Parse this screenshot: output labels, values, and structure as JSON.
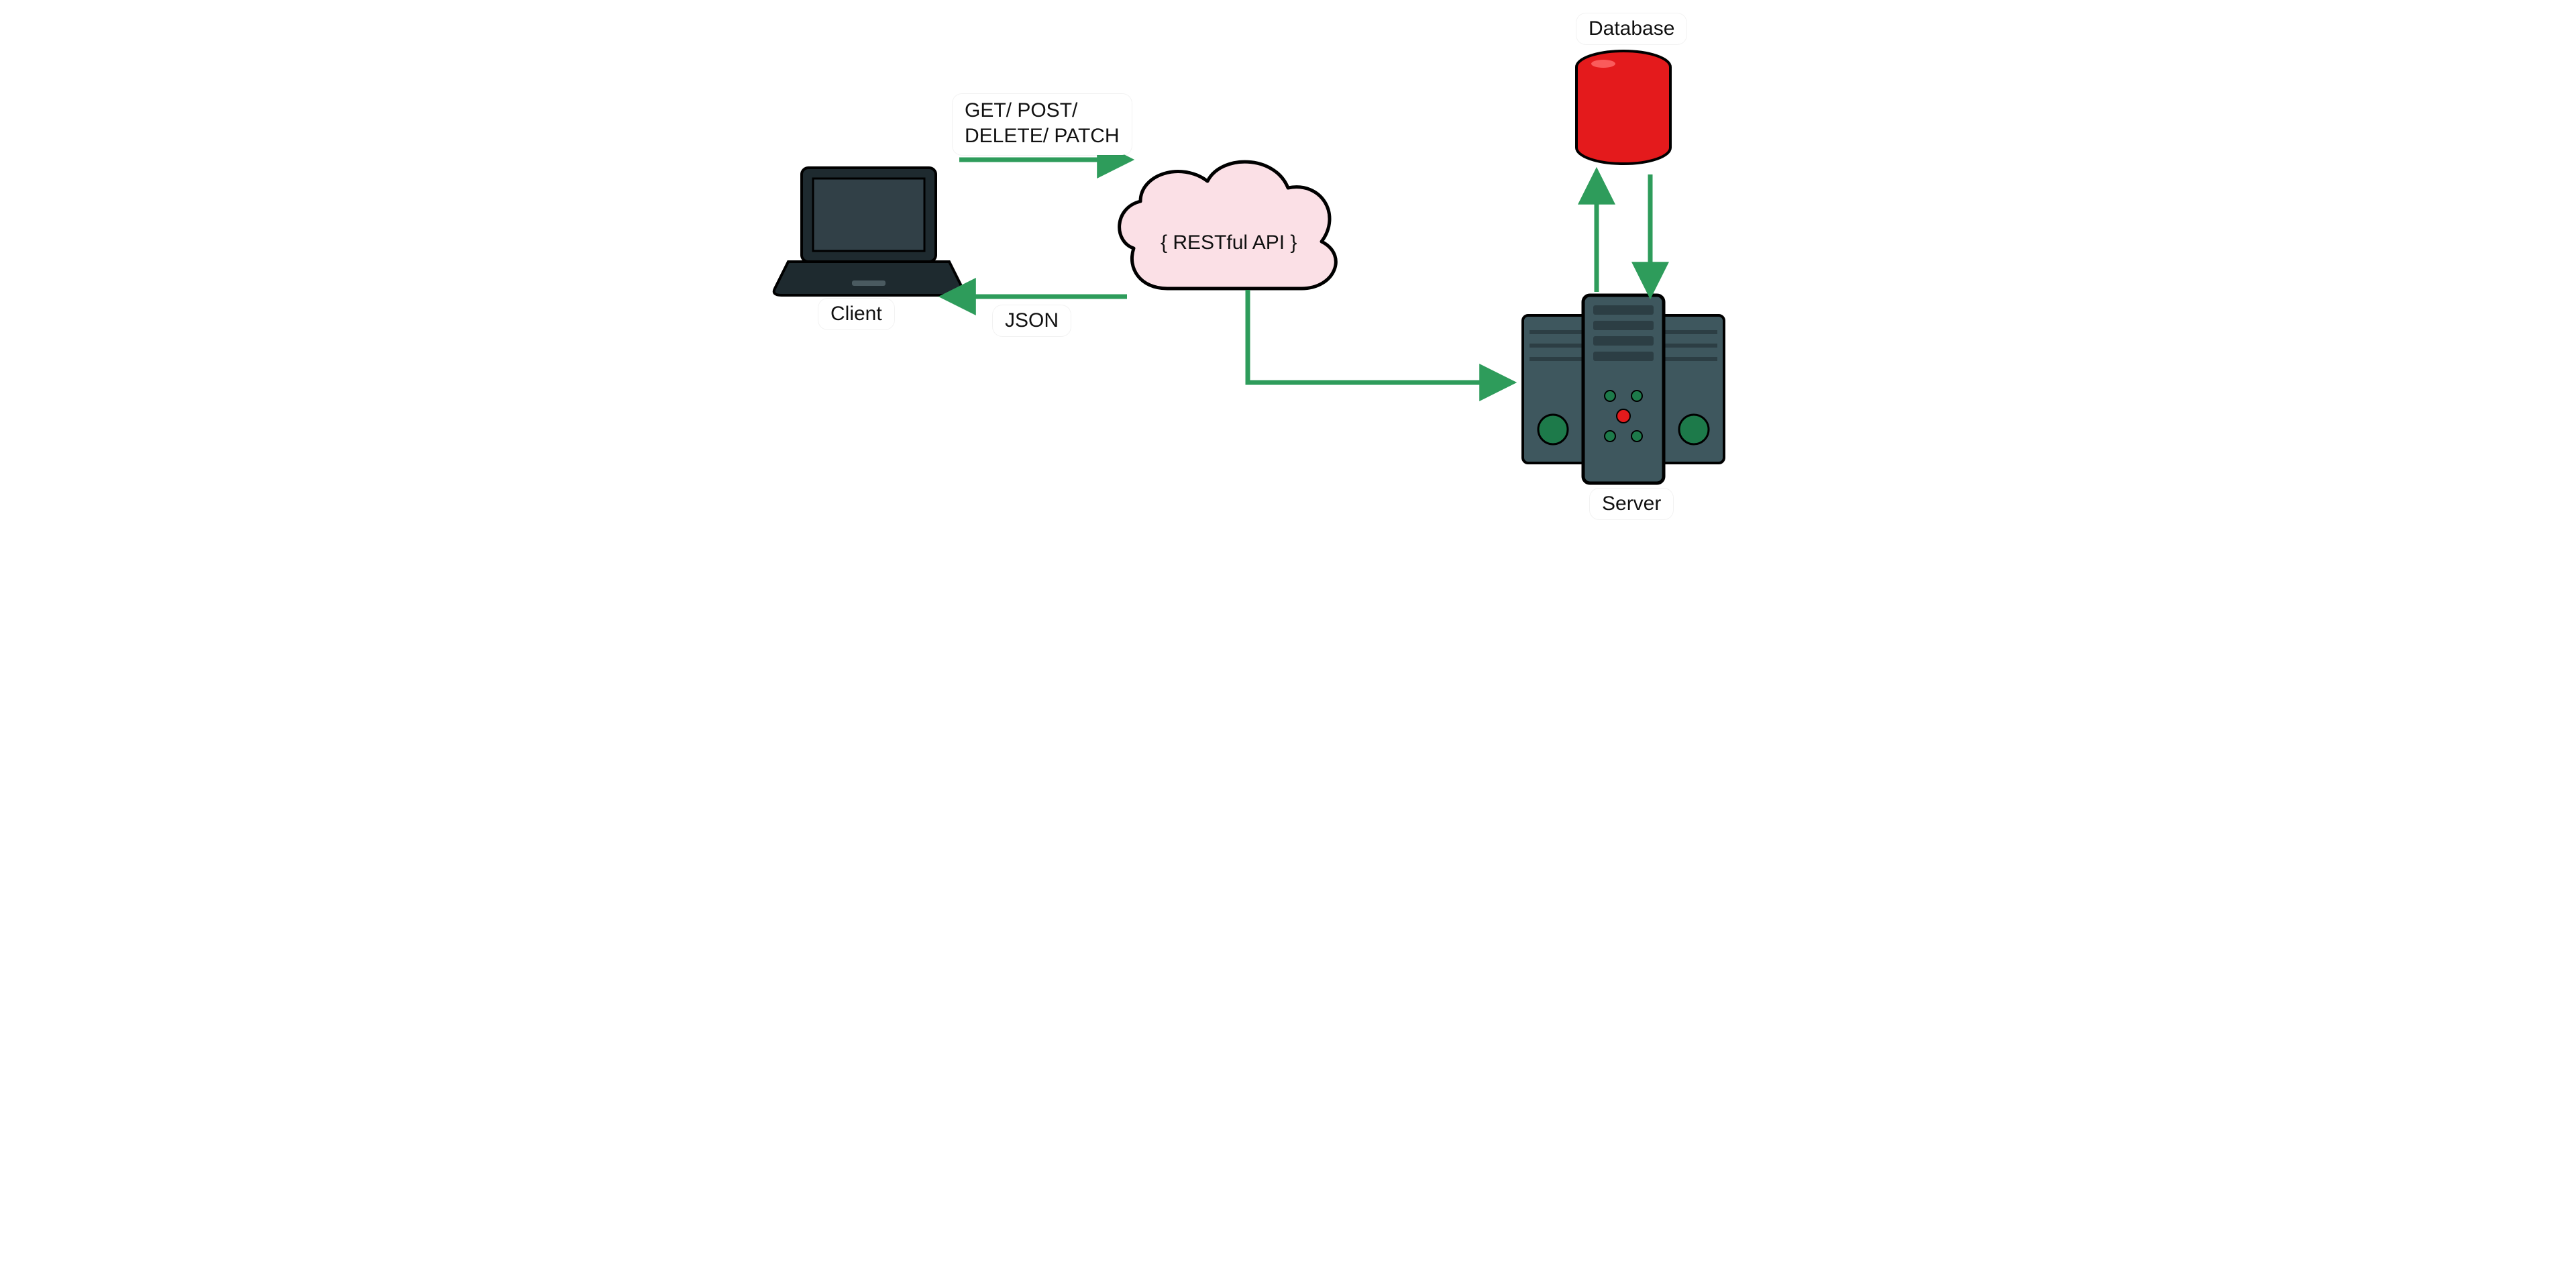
{
  "nodes": {
    "client": {
      "label": "Client"
    },
    "api": {
      "label": "{ RESTful API }"
    },
    "server": {
      "label": "Server"
    },
    "database": {
      "label": "Database"
    }
  },
  "edges": {
    "client_to_api": {
      "label_line1": "GET/ POST/",
      "label_line2": "DELETE/ PATCH"
    },
    "api_to_client": {
      "label": "JSON"
    }
  },
  "colors": {
    "arrow": "#2e9c5b",
    "cloud_fill": "#fbe0e6",
    "db_red": "#e41a1c",
    "server_body": "#3e575e",
    "server_dark": "#2c3e44",
    "server_green": "#1d7a4a",
    "laptop_body": "#1e2a2f"
  }
}
